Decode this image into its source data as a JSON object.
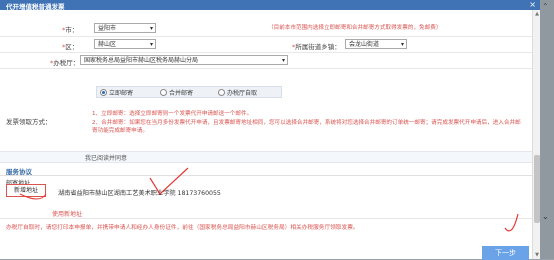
{
  "dialog": {
    "title": "代开增值税普通发票",
    "close": "×"
  },
  "city": {
    "label": "市：",
    "value": "益阳市",
    "note": "（目前本市范围内选择立即邮寄和合并邮寄方式取得发票的，免邮费）"
  },
  "district": {
    "label": "区：",
    "value": "赫山区",
    "street_label": "所属街道乡镇：",
    "street_value": "会龙山街道"
  },
  "office": {
    "label": "办税厅：",
    "value": "国家税务总局益阳市赫山区税务局赫山分局"
  },
  "delivery": {
    "label": "发票领取方式：",
    "options": [
      "立即邮寄",
      "合并邮寄",
      "办税厅自取"
    ],
    "notes": [
      "1、立即邮寄：选择立即邮寄则一个发票代开申请邮送一个邮件。",
      "2、合并邮寄：如果您在当月多份发票代开申请，且发票邮寄地址相同，您可以选择合并邮寄，系统将对您选择合并邮寄的订单统一邮寄；请完成发票代开申请后，进入合并邮寄功能完成邮寄申请。"
    ]
  },
  "confirm_text": "我已阅读并同意",
  "service_section": "服务协议",
  "mail_section": "邮寄地址",
  "new_address_button": "新增地址",
  "address": "湖南省益阳市赫山区湖南工艺美术职业学院 18173760055",
  "annotation": "使用新地址",
  "bottom_note": "办税厅自取时，请您打印本申报单，并携带申请人和经办人身份证件，前往（国家税务总局益阳市赫山区税务局）相关办税服务厅领取发票。",
  "next_button": "下一步",
  "colors": {
    "title_bar": "#3f73b5",
    "warn_red": "#d9534f",
    "primary": "#6aa3e8"
  }
}
